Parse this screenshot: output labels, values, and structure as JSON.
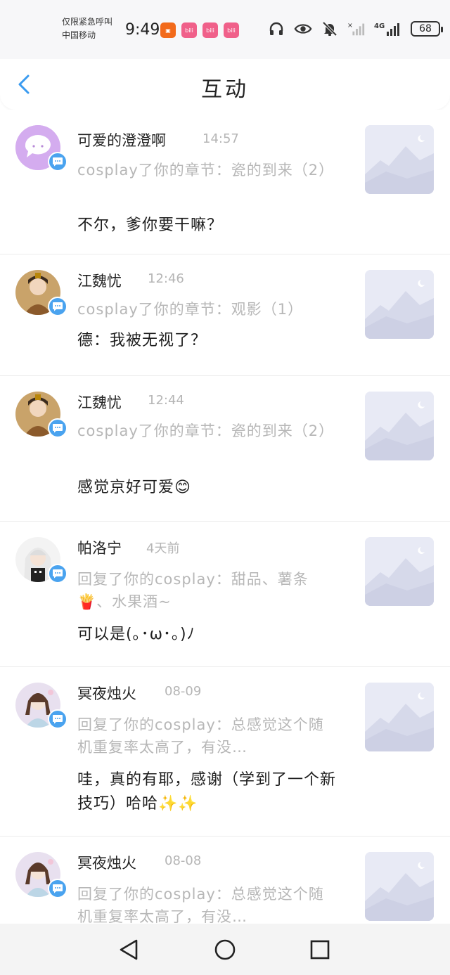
{
  "status_bar": {
    "carrier_line1": "仅限紧急呼叫",
    "carrier_line2": "中国移动",
    "time": "9:49",
    "network": "4G",
    "battery": "68",
    "app_icons": [
      "orange-app-icon",
      "bilibili-icon",
      "bilibili-icon",
      "bilibili-icon"
    ]
  },
  "header": {
    "title": "互动",
    "back_icon": "chevron-left-icon"
  },
  "colors": {
    "accent": "#4aa3ef",
    "secondary_text": "#b7b7b7",
    "thumb_bg": "#e9ebf6"
  },
  "items": [
    {
      "name": "可爱的澄澄啊",
      "time": "14:57",
      "quote": "cosplay了你的章节：瓷的到来（2）",
      "comment": "不尔，爹你要干嘛？"
    },
    {
      "name": "江魏忧",
      "time": "12:46",
      "quote": "cosplay了你的章节：观影（1）",
      "comment": "德：我被无视了？"
    },
    {
      "name": "江魏忧",
      "time": "12:44",
      "quote": "cosplay了你的章节：瓷的到来（2）",
      "comment": "感觉京好可爱😊"
    },
    {
      "name": "帕洛宁",
      "time": "4天前",
      "quote": "回复了你的cosplay：甜品、薯条🍟、水果酒~",
      "comment": "可以是(｡･ω･｡)ﾉ"
    },
    {
      "name": "冥夜烛火",
      "time": "08-09",
      "quote": "回复了你的cosplay：总感觉这个随机重复率太高了，有没…",
      "comment": "哇，真的有耶，感谢（学到了一个新技巧）哈哈✨✨"
    },
    {
      "name": "冥夜烛火",
      "time": "08-08",
      "quote": "回复了你的cosplay：总感觉这个随机重复率太高了，有没…",
      "comment": ""
    }
  ],
  "system_nav": {
    "back": "triangle-back-icon",
    "home": "circle-home-icon",
    "recent": "square-recent-icon"
  }
}
